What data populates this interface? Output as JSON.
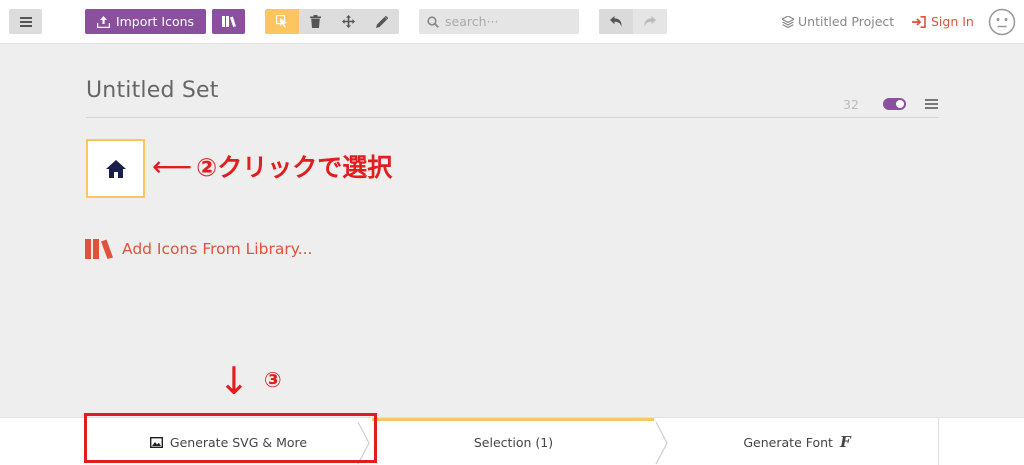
{
  "topbar": {
    "import_label": "Import Icons",
    "search_placeholder": "search···",
    "project_label": "Untitled Project",
    "signin_label": "Sign In"
  },
  "set": {
    "title": "Untitled Set",
    "count": "32",
    "add_library_label": "Add Icons From Library..."
  },
  "annotations": {
    "step2_arrow": "⟵",
    "step2_text": "②クリックで選択",
    "step3_arrow": "↓",
    "step3_text": "③"
  },
  "bottombar": {
    "generate_svg_label": "Generate SVG & More",
    "selection_label": "Selection (1)",
    "generate_font_label": "Generate Font",
    "font_glyph": "F"
  },
  "colors": {
    "brand_purple": "#8a4f9d",
    "accent_yellow": "#fdc560",
    "link_red": "#e0523b",
    "annotation_red": "#e01e1e"
  }
}
